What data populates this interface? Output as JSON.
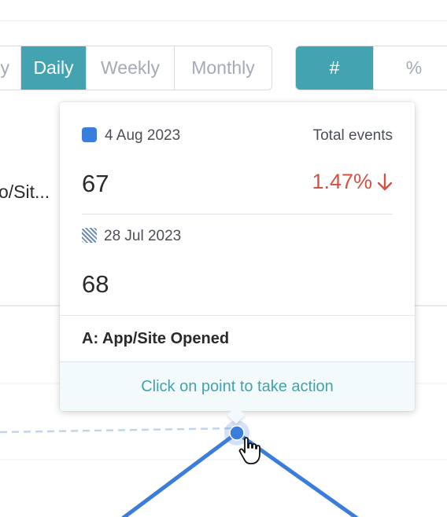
{
  "granularity": {
    "options": [
      "y",
      "Daily",
      "Weekly",
      "Monthly"
    ],
    "selected": "Daily"
  },
  "mode": {
    "options": [
      "#",
      "%"
    ],
    "selected": "#"
  },
  "event_label_truncated": "o/Sit...",
  "tooltip": {
    "current": {
      "date": "4 Aug 2023",
      "value": "67",
      "swatch_color": "#3b7ddd"
    },
    "metric_label": "Total events",
    "change": "1.47%",
    "change_direction": "down",
    "change_color": "#d35246",
    "previous": {
      "date": "28 Jul 2023",
      "value": "68"
    },
    "event_name": "A: App/Site Opened",
    "footer_action": "Click on point to take action"
  },
  "colors": {
    "accent": "#44a3b0",
    "series_line": "#3b7ddd",
    "compare_line": "#c3d3ea"
  }
}
